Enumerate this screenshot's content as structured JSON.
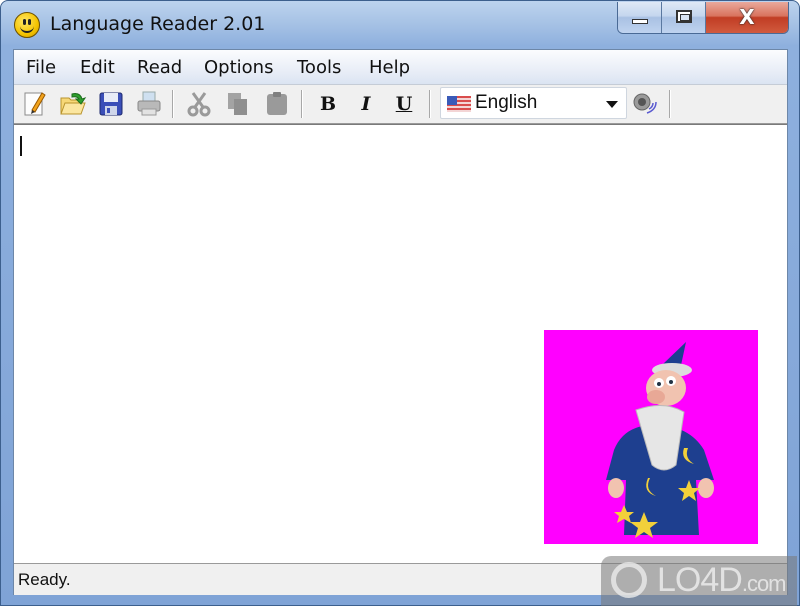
{
  "window": {
    "title": "Language Reader 2.01",
    "app_icon": "smiley-icon",
    "controls": {
      "minimize": "minimize-icon",
      "maximize": "maximize-icon",
      "close_label": "X"
    }
  },
  "menubar": {
    "items": [
      {
        "label": "File"
      },
      {
        "label": "Edit"
      },
      {
        "label": "Read"
      },
      {
        "label": "Options"
      },
      {
        "label": "Tools"
      },
      {
        "label": "Help"
      }
    ]
  },
  "toolbar": {
    "buttons": [
      {
        "icon": "new-document-icon",
        "tooltip": "New",
        "enabled": true
      },
      {
        "icon": "open-folder-icon",
        "tooltip": "Open",
        "enabled": true
      },
      {
        "icon": "save-disk-icon",
        "tooltip": "Save",
        "enabled": true
      },
      {
        "icon": "printer-icon",
        "tooltip": "Print",
        "enabled": false
      },
      {
        "icon": "cut-scissors-icon",
        "tooltip": "Cut",
        "enabled": false
      },
      {
        "icon": "copy-icon",
        "tooltip": "Copy",
        "enabled": false
      },
      {
        "icon": "paste-icon",
        "tooltip": "Paste",
        "enabled": false
      }
    ],
    "format": {
      "bold": "B",
      "italic": "I",
      "underline": "U"
    },
    "language": {
      "selected": "English",
      "flag": "us-flag-icon"
    },
    "speak_icon": "speaker-icon"
  },
  "editor": {
    "text": ""
  },
  "agent": {
    "character": "wizard",
    "background": "#ff00ff"
  },
  "statusbar": {
    "text": "Ready."
  },
  "watermark": {
    "text": "LO4D",
    "suffix": ".com"
  }
}
